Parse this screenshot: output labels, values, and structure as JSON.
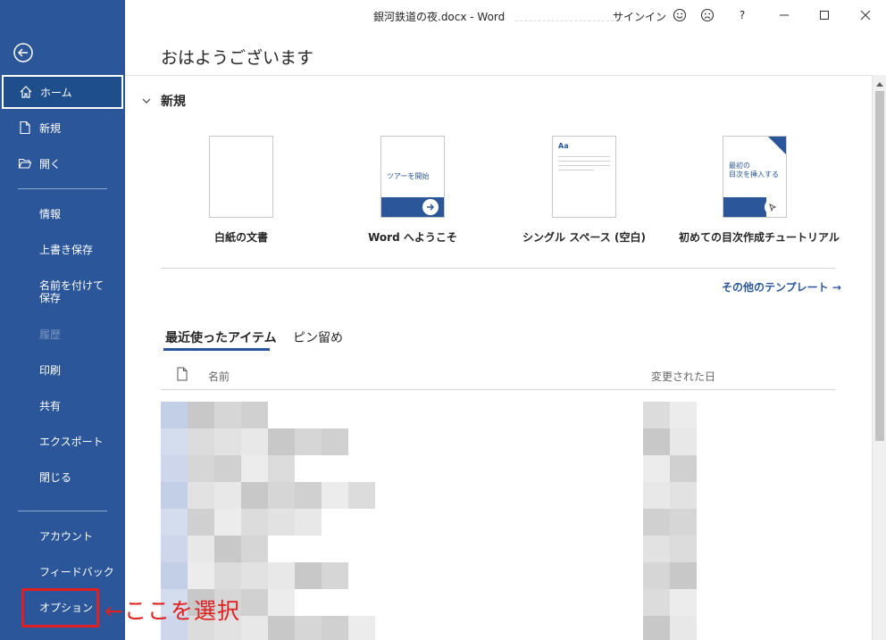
{
  "window": {
    "title": "銀河鉄道の夜.docx  -  Word",
    "signin_label": "サインイン",
    "help_label": "?"
  },
  "sidebar": {
    "items_top": [
      {
        "key": "home",
        "label": "ホーム",
        "icon": "home-icon"
      },
      {
        "key": "new",
        "label": "新規",
        "icon": "new-doc-icon"
      },
      {
        "key": "open",
        "label": "開く",
        "icon": "folder-open-icon"
      }
    ],
    "items_mid": [
      {
        "key": "info",
        "label": "情報"
      },
      {
        "key": "save",
        "label": "上書き保存"
      },
      {
        "key": "saveas",
        "label": "名前を付けて保存"
      },
      {
        "key": "history",
        "label": "履歴"
      },
      {
        "key": "print",
        "label": "印刷"
      },
      {
        "key": "share",
        "label": "共有"
      },
      {
        "key": "export",
        "label": "エクスポート"
      },
      {
        "key": "close",
        "label": "閉じる"
      }
    ],
    "items_bottom": [
      {
        "key": "account",
        "label": "アカウント"
      },
      {
        "key": "feedback",
        "label": "フィードバック"
      },
      {
        "key": "options",
        "label": "オプション"
      }
    ]
  },
  "main": {
    "greeting": "おはようございます",
    "new_section": {
      "label": "新規",
      "templates": [
        {
          "label": "白紙の文書"
        },
        {
          "label": "Word へようこそ",
          "thumb_text": "ツアーを開始"
        },
        {
          "label": "シングル スペース (空白)",
          "thumb_text": "Aa"
        },
        {
          "label": "初めての目次作成チュートリアル",
          "thumb_text": "最初の\n目次を挿入する"
        }
      ],
      "more_templates": "その他のテンプレート →"
    },
    "tabs": [
      {
        "label": "最近使ったアイテム",
        "active": true
      },
      {
        "label": "ピン留め",
        "active": false
      }
    ],
    "columns": {
      "name": "名前",
      "modified": "変更された日"
    }
  },
  "annotation": {
    "text": "←ここを選択",
    "color": "#e02020"
  },
  "colors": {
    "sidebar": "#2b579a",
    "accent": "#2b579a"
  }
}
